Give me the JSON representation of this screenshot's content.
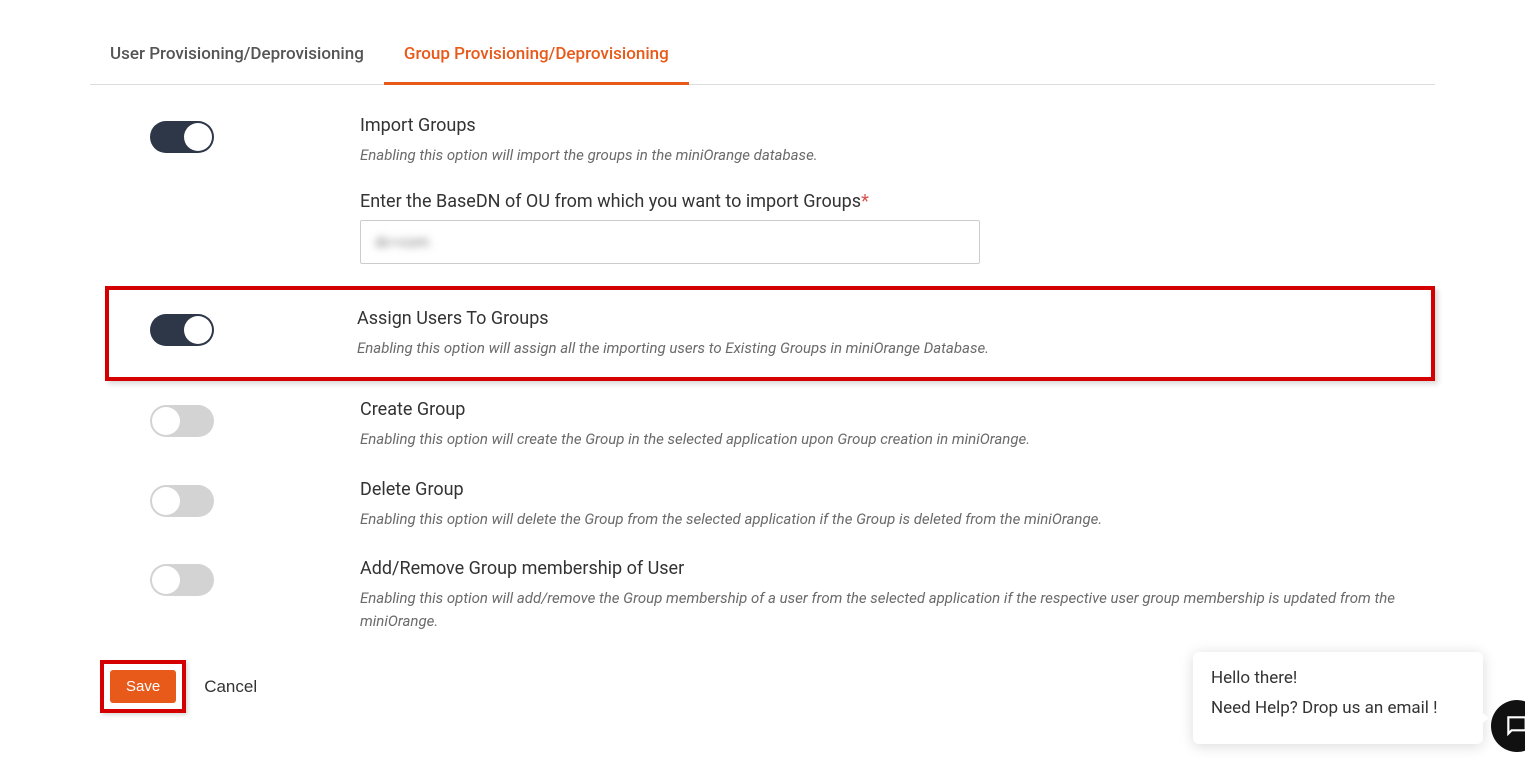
{
  "tabs": {
    "user": "User Provisioning/Deprovisioning",
    "group": "Group Provisioning/Deprovisioning"
  },
  "options": {
    "importGroups": {
      "title": "Import Groups",
      "desc": "Enabling this option will import the groups in the miniOrange database.",
      "on": true
    },
    "basedn": {
      "label": "Enter the BaseDN of OU from which you want to import Groups",
      "value": "dc=com"
    },
    "assignUsers": {
      "title": "Assign Users To Groups",
      "desc": "Enabling this option will assign all the importing users to Existing Groups in miniOrange Database.",
      "on": true
    },
    "createGroup": {
      "title": "Create Group",
      "desc": "Enabling this option will create the Group in the selected application upon Group creation in miniOrange.",
      "on": false
    },
    "deleteGroup": {
      "title": "Delete Group",
      "desc": "Enabling this option will delete the Group from the selected application if the Group is deleted from the miniOrange.",
      "on": false
    },
    "addRemove": {
      "title": "Add/Remove Group membership of User",
      "desc": "Enabling this option will add/remove the Group membership of a user from the selected application if the respective user group membership is updated from the miniOrange.",
      "on": false
    }
  },
  "actions": {
    "save": "Save",
    "cancel": "Cancel"
  },
  "chat": {
    "line1": "Hello there!",
    "line2": "Need Help? Drop us an email !"
  }
}
